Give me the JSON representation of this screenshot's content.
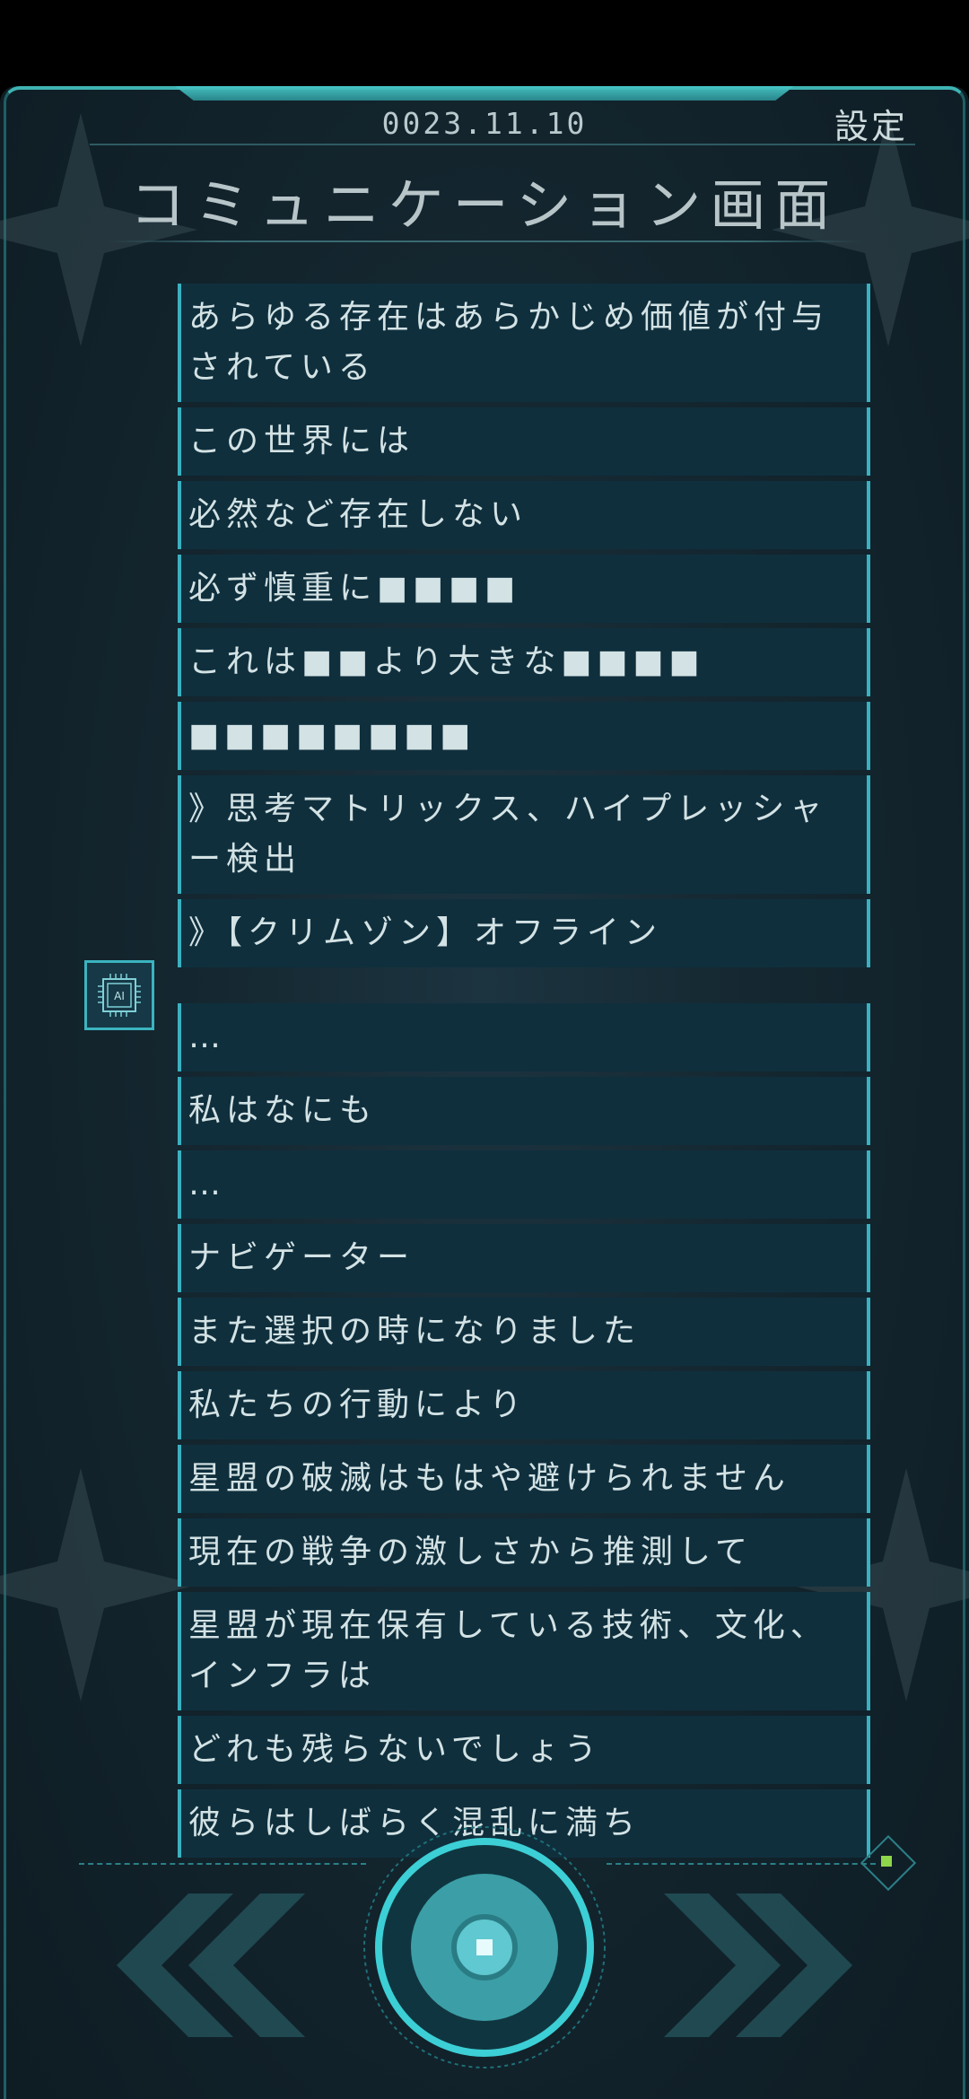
{
  "header": {
    "date": "0023.11.10",
    "settings_label": "設定",
    "title": "コミュニケーション画面"
  },
  "messages_group1": [
    "あらゆる存在はあらかじめ価値が付与されている",
    "この世界には",
    "必然など存在しない",
    "必ず慎重に■■■■",
    "これは■■より大きな■■■■",
    "■■■■■■■■",
    "》思考マトリックス、ハイプレッシャー検出",
    "》【クリムゾン】オフライン"
  ],
  "ai_badge_label": "AI",
  "messages_group2": [
    "…",
    "私はなにも",
    "…",
    "ナビゲーター",
    "また選択の時になりました",
    "私たちの行動により",
    "星盟の破滅はもはや避けられません",
    "現在の戦争の激しさから推測して",
    "星盟が現在保有している技術、文化、インフラは",
    "どれも残らないでしょう",
    "彼らはしばらく混乱に満ち"
  ],
  "icons": {
    "prev": "double-chevron-left-icon",
    "next": "double-chevron-right-icon",
    "center": "round-action-button-icon",
    "ai": "ai-chip-icon"
  },
  "colors": {
    "accent": "#3ab0c0",
    "panel": "#0f2f3d",
    "text": "#d3e2e4"
  }
}
